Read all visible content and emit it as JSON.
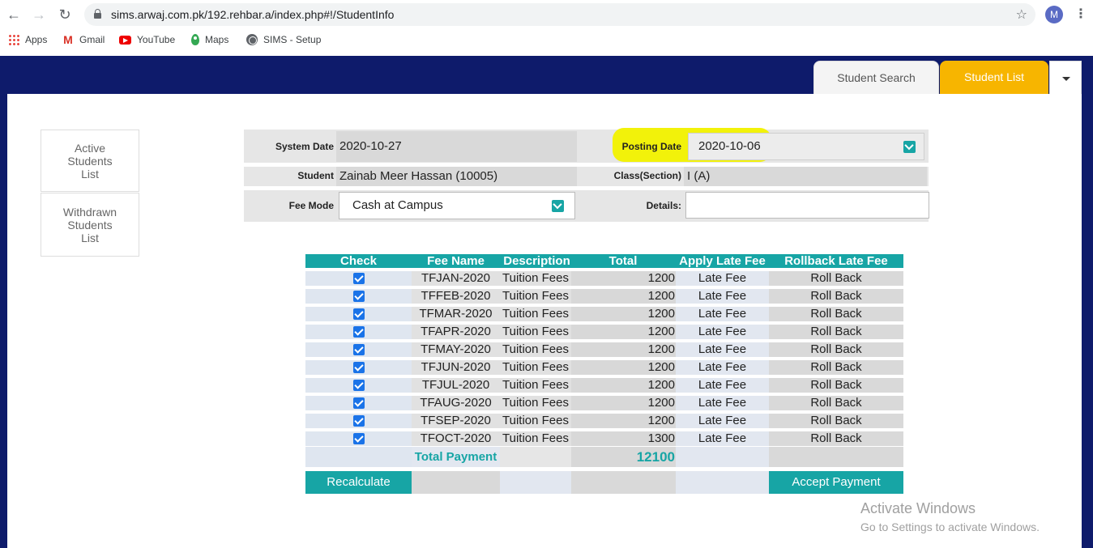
{
  "browser": {
    "url": "sims.arwaj.com.pk/192.rehbar.a/index.php#!/StudentInfo",
    "profile_initial": "M",
    "bookmarks": [
      "Apps",
      "Gmail",
      "YouTube",
      "Maps",
      "SIMS - Setup"
    ]
  },
  "tabs": {
    "search": "Student Search",
    "list": "Student List"
  },
  "sidebar": {
    "active": "Active Students List",
    "withdrawn": "Withdrawn Students List"
  },
  "form": {
    "system_date_label": "System Date",
    "system_date": "2020-10-27",
    "posting_date_label": "Posting Date",
    "posting_date": "2020-10-06",
    "student_label": "Student",
    "student": "Zainab Meer Hassan (10005)",
    "class_label": "Class(Section)",
    "class": "I (A)",
    "fee_mode_label": "Fee Mode",
    "fee_mode": "Cash at Campus",
    "details_label": "Details:",
    "details": ""
  },
  "table": {
    "headers": [
      "Check",
      "Fee Name",
      "Description",
      "Total",
      "Apply Late Fee",
      "Rollback Late Fee"
    ],
    "rows": [
      {
        "name": "TFJAN-2020",
        "desc": "Tuition Fees",
        "total": "1200",
        "late": "Late Fee",
        "roll": "Roll Back"
      },
      {
        "name": "TFFEB-2020",
        "desc": "Tuition Fees",
        "total": "1200",
        "late": "Late Fee",
        "roll": "Roll Back"
      },
      {
        "name": "TFMAR-2020",
        "desc": "Tuition Fees",
        "total": "1200",
        "late": "Late Fee",
        "roll": "Roll Back"
      },
      {
        "name": "TFAPR-2020",
        "desc": "Tuition Fees",
        "total": "1200",
        "late": "Late Fee",
        "roll": "Roll Back"
      },
      {
        "name": "TFMAY-2020",
        "desc": "Tuition Fees",
        "total": "1200",
        "late": "Late Fee",
        "roll": "Roll Back"
      },
      {
        "name": "TFJUN-2020",
        "desc": "Tuition Fees",
        "total": "1200",
        "late": "Late Fee",
        "roll": "Roll Back"
      },
      {
        "name": "TFJUL-2020",
        "desc": "Tuition Fees",
        "total": "1200",
        "late": "Late Fee",
        "roll": "Roll Back"
      },
      {
        "name": "TFAUG-2020",
        "desc": "Tuition Fees",
        "total": "1200",
        "late": "Late Fee",
        "roll": "Roll Back"
      },
      {
        "name": "TFSEP-2020",
        "desc": "Tuition Fees",
        "total": "1200",
        "late": "Late Fee",
        "roll": "Roll Back"
      },
      {
        "name": "TFOCT-2020",
        "desc": "Tuition Fees",
        "total": "1300",
        "late": "Late Fee",
        "roll": "Roll Back"
      }
    ],
    "total_label": "Total Payment",
    "total_value": "12100"
  },
  "buttons": {
    "recalculate": "Recalculate",
    "accept": "Accept Payment"
  },
  "watermark": {
    "line1": "Activate Windows",
    "line2": "Go to Settings to activate Windows."
  },
  "colors": {
    "navy": "#0e1b6b",
    "teal": "#17a5a5",
    "amber": "#f7b500",
    "highlight": "#f2f20a"
  }
}
